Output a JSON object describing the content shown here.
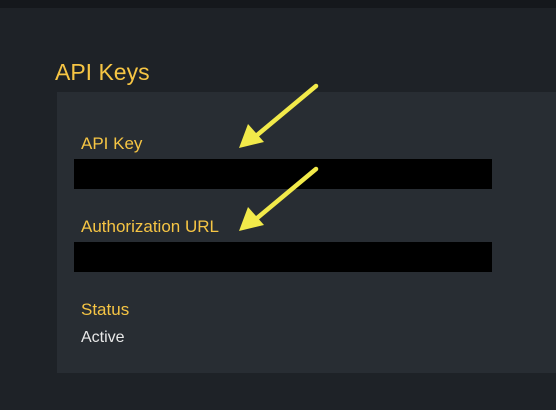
{
  "section": {
    "title": "API Keys"
  },
  "fields": {
    "api_key": {
      "label": "API Key",
      "value": ""
    },
    "authorization_url": {
      "label": "Authorization URL",
      "value": ""
    },
    "status": {
      "label": "Status",
      "value": "Active"
    }
  },
  "colors": {
    "background": "#1e2227",
    "panel": "#282d33",
    "accent_label": "#f6c544",
    "annotation_arrow": "#f2ea4a",
    "redaction": "#000000",
    "value_text": "#e8e8e8"
  },
  "annotations": {
    "arrow_icon": "annotation-arrow",
    "count": 2
  }
}
